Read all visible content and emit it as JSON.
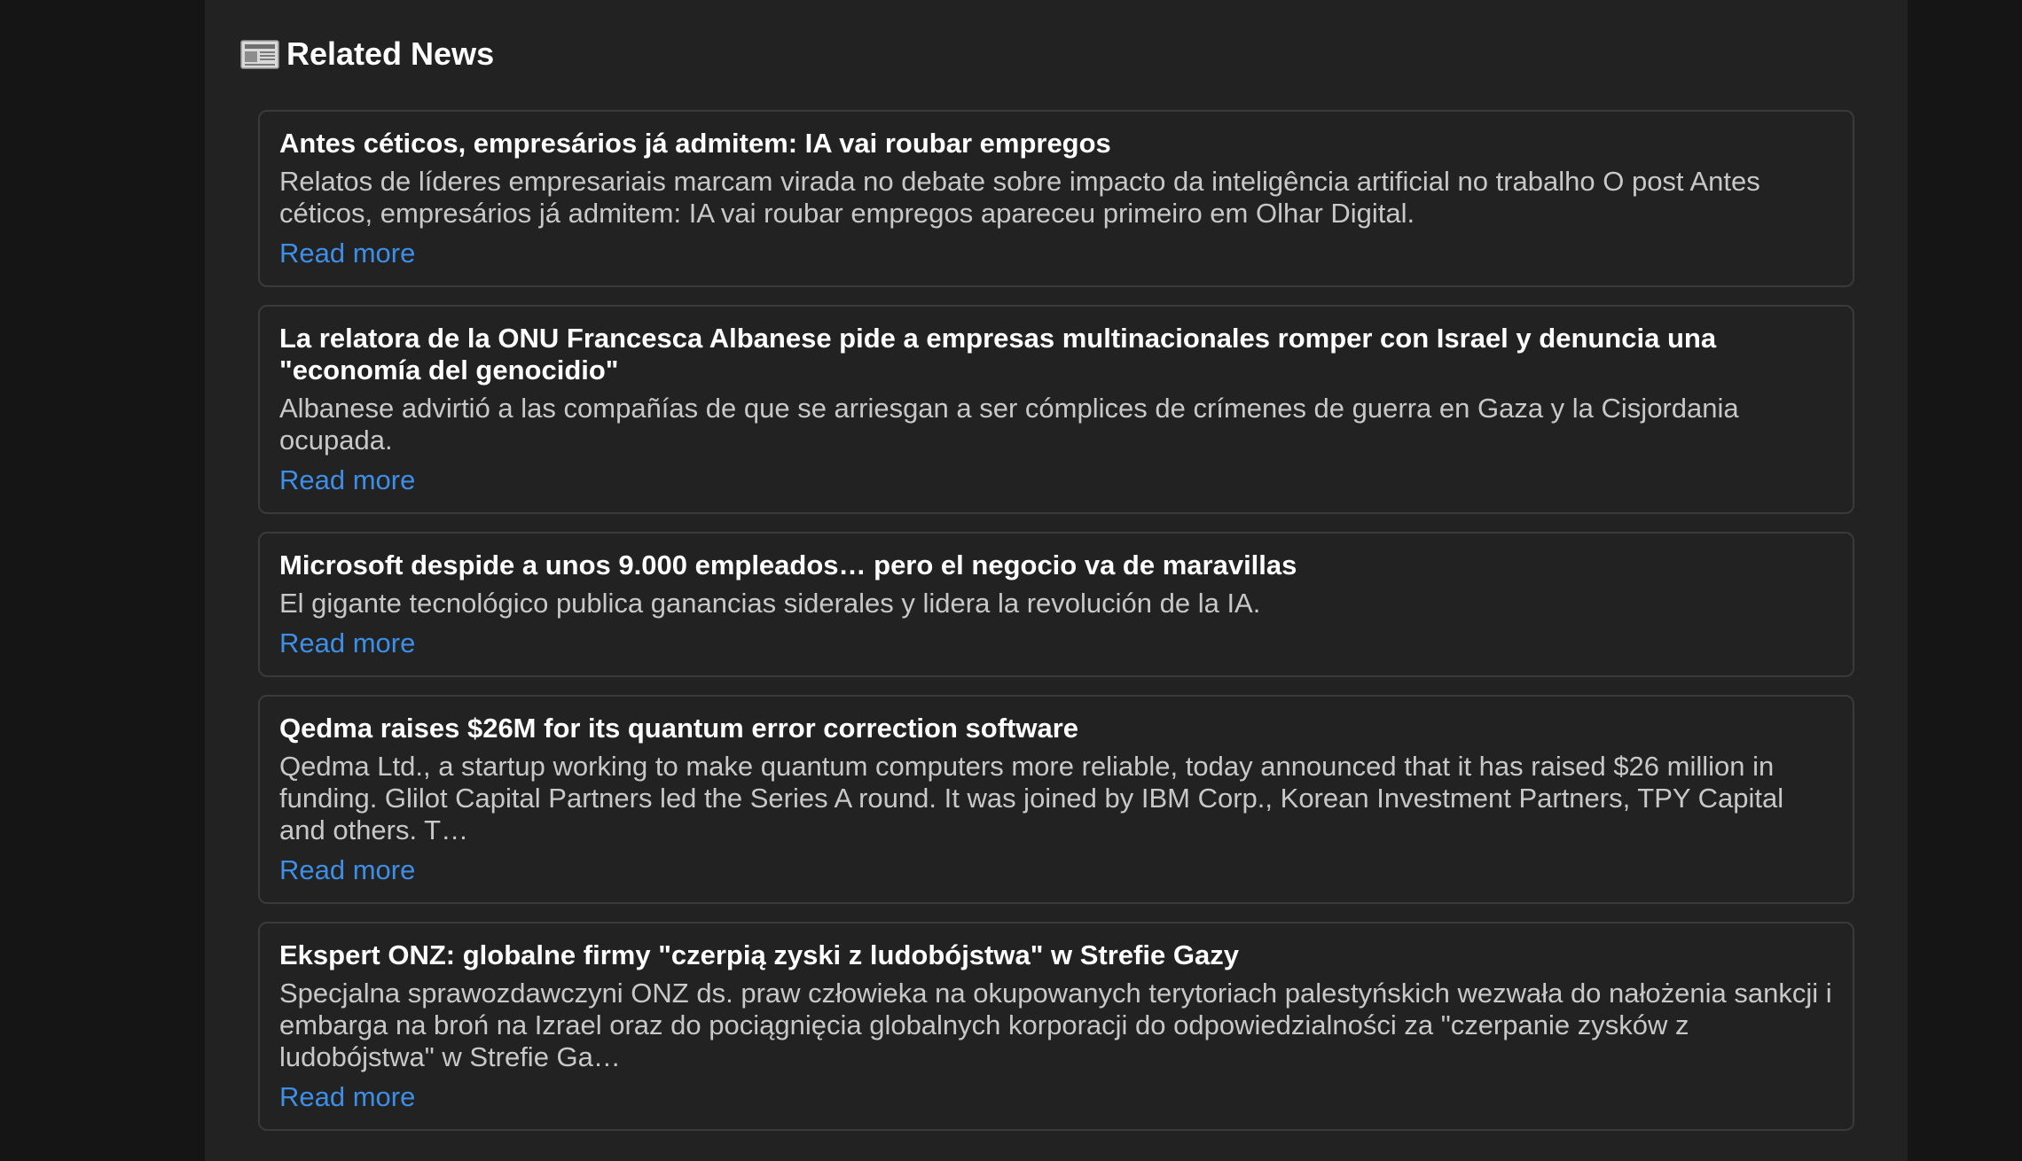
{
  "section": {
    "title": "Related News",
    "icon": "newspaper-icon"
  },
  "news": [
    {
      "title": "Antes céticos, empresários já admitem: IA vai roubar empregos",
      "description": "Relatos de líderes empresariais marcam virada no debate sobre impacto da inteligência artificial no trabalho O post Antes céticos, empresários já admitem: IA vai roubar empregos apareceu primeiro em Olhar Digital.",
      "link_label": "Read more"
    },
    {
      "title": "La relatora de la ONU Francesca Albanese pide a empresas multinacionales romper con Israel y denuncia una \"economía del genocidio\"",
      "description": "Albanese advirtió a las compañías de que se arriesgan a ser cómplices de crímenes de guerra en Gaza y la Cisjordania ocupada.",
      "link_label": "Read more"
    },
    {
      "title": "Microsoft despide a unos 9.000 empleados… pero el negocio va de maravillas",
      "description": "El gigante tecnológico publica ganancias siderales y lidera la revolución de la IA.",
      "link_label": "Read more"
    },
    {
      "title": "Qedma raises $26M for its quantum error correction software",
      "description": "Qedma Ltd., a startup working to make quantum computers more reliable, today announced that it has raised $26 million in funding. Glilot Capital Partners led the Series A round. It was joined by IBM Corp., Korean Investment Partners, TPY Capital and others. T…",
      "link_label": "Read more"
    },
    {
      "title": "Ekspert ONZ: globalne firmy \"czerpią zyski z ludobójstwa\" w Strefie Gazy",
      "description": "Specjalna sprawozdawczyni ONZ ds. praw człowieka na okupowanych terytoriach palestyńskich wezwała do nałożenia sankcji i embarga na broń na Izrael oraz do pociągnięcia globalnych korporacji do odpowiedzialności za \"czerpanie zysków z ludobójstwa\" w Strefie Ga…",
      "link_label": "Read more"
    }
  ]
}
